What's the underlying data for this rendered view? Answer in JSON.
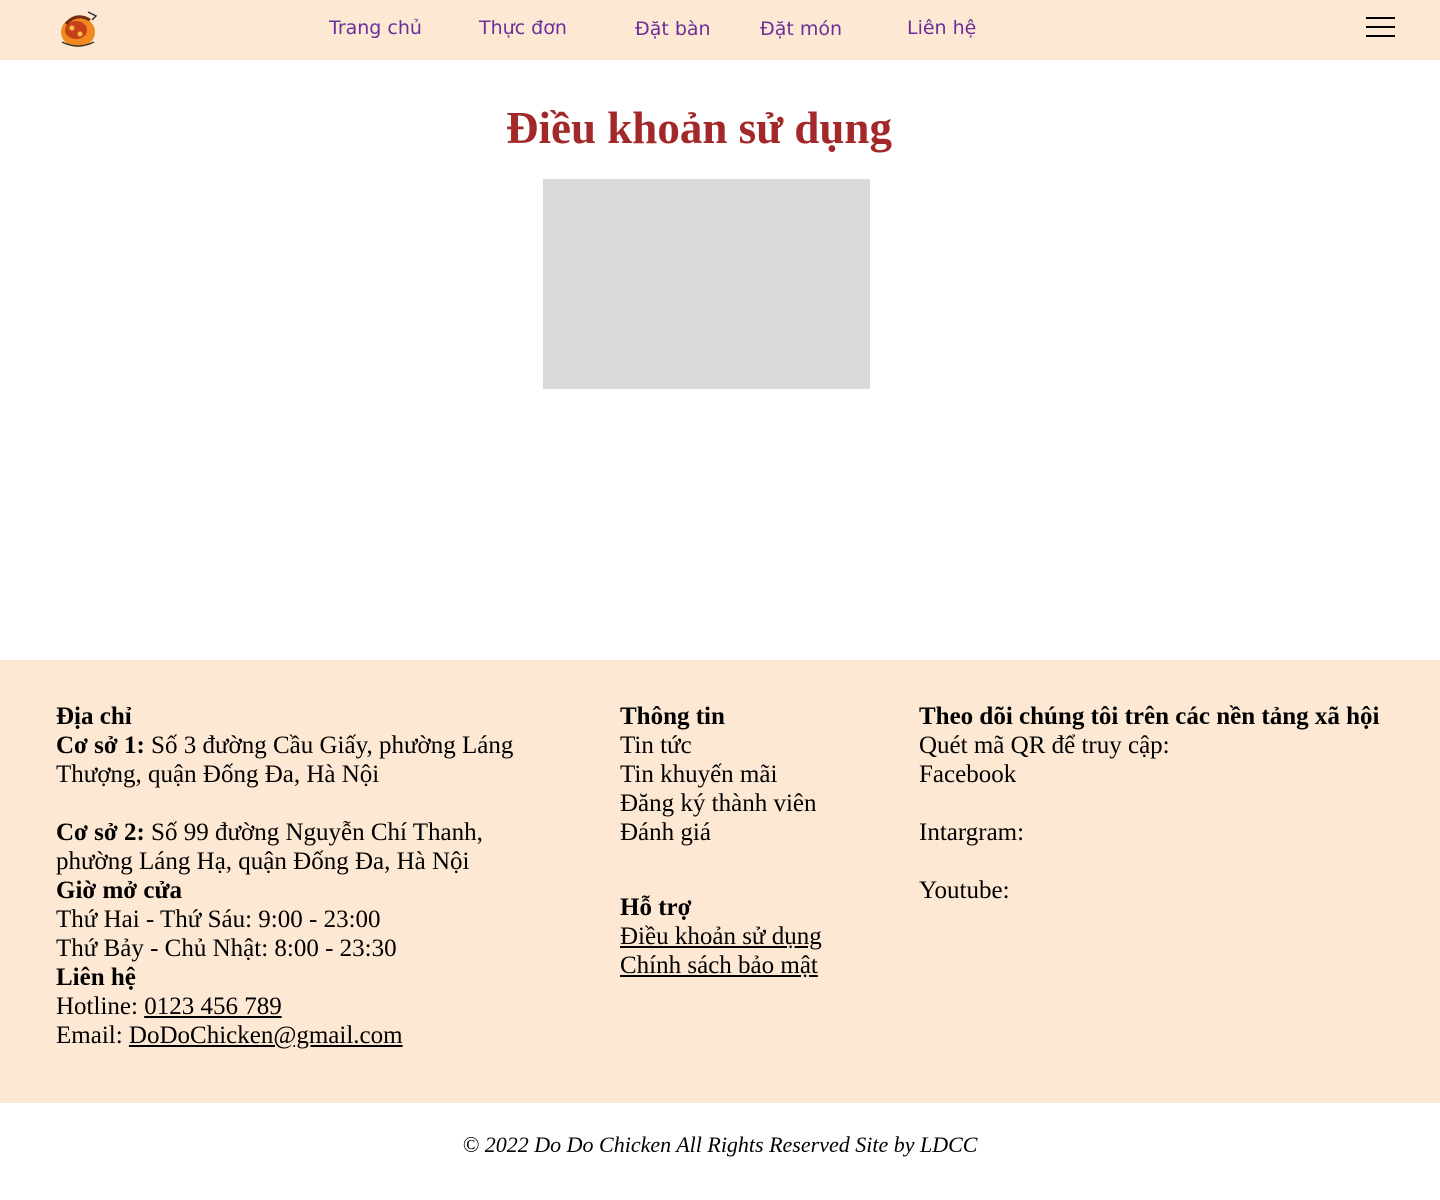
{
  "nav": {
    "items": [
      "Trang chủ",
      "Thực đơn",
      "Đặt bàn",
      "Đặt món",
      "Liên hệ"
    ]
  },
  "colors": {
    "header_bg": "#fde9d3",
    "nav_text": "#6b2f9a",
    "title": "#a3282a",
    "footer_bg": "#fde9d3",
    "placeholder": "#d9d9d9"
  },
  "page": {
    "title": "Điều khoản sử dụng"
  },
  "footer": {
    "address": {
      "heading": "Địa chỉ",
      "branch1_label": "Cơ sở 1:",
      "branch1_text": "Số 3 đường Cầu Giấy, phường Láng Thượng, quận Đống Đa, Hà Nội",
      "branch2_label": "Cơ sở 2:",
      "branch2_text": "Số 99 đường Nguyễn Chí Thanh, phường Láng Hạ, quận Đống Đa, Hà Nội"
    },
    "hours": {
      "heading": "Giờ mở cửa",
      "weekday": "Thứ Hai - Thứ Sáu: 9:00 - 23:00",
      "weekend": "Thứ Bảy - Chủ Nhật: 8:00 - 23:30"
    },
    "contact": {
      "heading": "Liên hệ",
      "hotline_label": "Hotline:",
      "hotline": "0123 456 789",
      "email_label": "Email:",
      "email": "DoDoChicken@gmail.com"
    },
    "info": {
      "heading": "Thông tin",
      "items": [
        "Tin tức",
        "Tin khuyến mãi",
        "Đăng ký thành viên",
        "Đánh giá"
      ]
    },
    "support": {
      "heading": "Hỗ trợ",
      "links": [
        "Điều khoản sử dụng",
        "Chính sách bảo mật"
      ]
    },
    "social": {
      "heading": "Theo dõi chúng tôi trên các nền tảng xã hội",
      "intro": "Quét mã QR để truy cập:",
      "facebook": "Facebook",
      "instagram": "Intargram:",
      "youtube": "Youtube:"
    }
  },
  "copyright": "© 2022 Do Do Chicken All Rights Reserved Site by LDCC"
}
